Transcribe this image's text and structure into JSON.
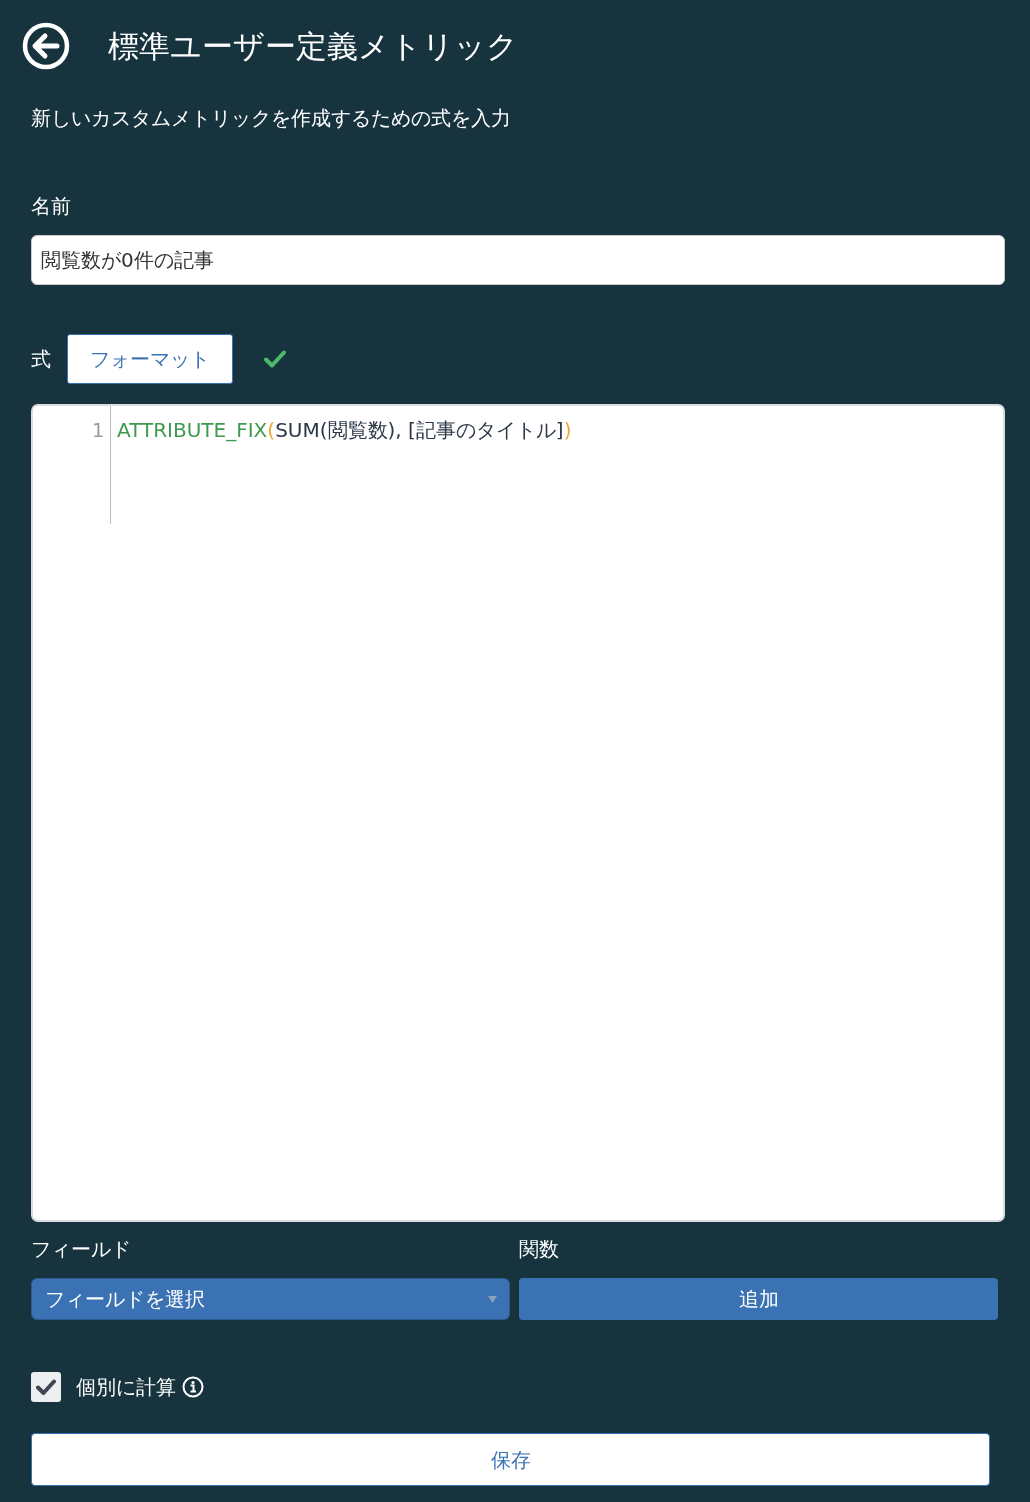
{
  "header": {
    "title": "標準ユーザー定義メトリック",
    "subtitle": "新しいカスタムメトリックを作成するための式を入力"
  },
  "name_field": {
    "label": "名前",
    "value": "閲覧数が0件の記事"
  },
  "formula": {
    "label": "式",
    "format_button": "フォーマット",
    "valid": true,
    "lines": [
      {
        "number": "1",
        "tokens": [
          {
            "kind": "function",
            "text": "ATTRIBUTE_FIX"
          },
          {
            "kind": "bracket",
            "text": "("
          },
          {
            "kind": "plain",
            "text": "SUM(閲覧数), [記事のタイトル]"
          },
          {
            "kind": "bracket",
            "text": ")"
          }
        ]
      }
    ]
  },
  "field_picker": {
    "label": "フィールド",
    "select": "フィールドを選択"
  },
  "functions": {
    "label": "関数",
    "add_button": "追加"
  },
  "per_item": {
    "label": "個別に計算",
    "checked": true
  },
  "save_button": "保存"
}
